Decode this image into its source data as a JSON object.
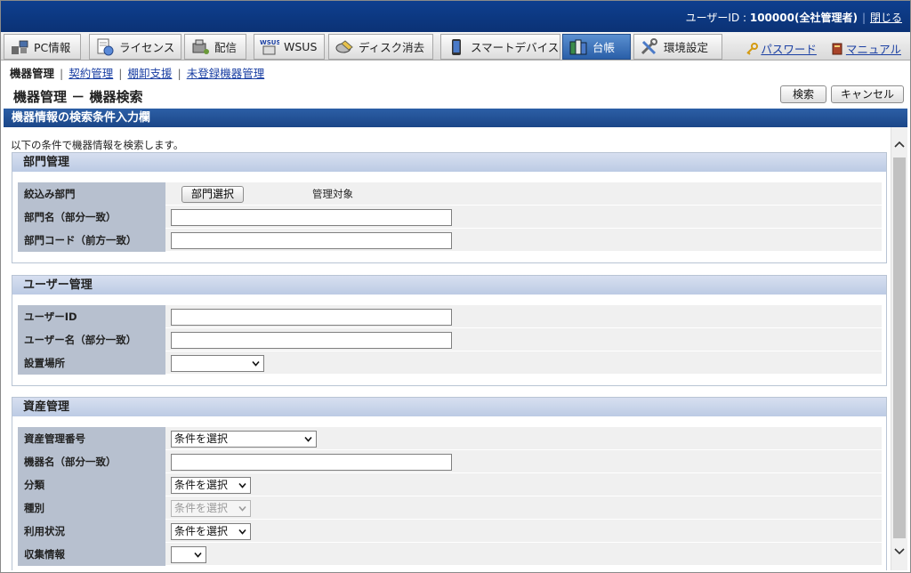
{
  "header": {
    "user_label": "ユーザーID : ",
    "user_value": "100000(全社管理者)",
    "close_label": "閉じる"
  },
  "nav": {
    "tabs": [
      {
        "label": "PC情報",
        "icon": "pc-info-icon"
      },
      {
        "label": "ライセンス",
        "icon": "license-icon"
      },
      {
        "label": "配信",
        "icon": "delivery-icon"
      },
      {
        "label": "WSUS",
        "icon": "wsus-icon"
      },
      {
        "label": "ディスク消去",
        "icon": "disk-erase-icon"
      },
      {
        "label": "スマートデバイス",
        "icon": "smart-device-icon"
      },
      {
        "label": "台帳",
        "icon": "ledger-icon",
        "active": true
      },
      {
        "label": "環境設定",
        "icon": "settings-tools-icon"
      }
    ],
    "password_label": "パスワード",
    "manual_label": "マニュアル"
  },
  "subnav": {
    "current": "機器管理",
    "links": [
      "契約管理",
      "棚卸支援",
      "未登録機器管理"
    ]
  },
  "page": {
    "title": "機器管理 － 機器検索",
    "search_button": "検索",
    "cancel_button": "キャンセル",
    "section_title": "機器情報の検索条件入力欄",
    "intro": "以下の条件で機器情報を検索します。"
  },
  "groups": {
    "dept": {
      "title": "部門管理",
      "filter_label": "絞込み部門",
      "select_button": "部門選択",
      "managed_text": "管理対象",
      "name_label": "部門名（部分一致）",
      "code_label": "部門コード（前方一致）"
    },
    "user": {
      "title": "ユーザー管理",
      "id_label": "ユーザーID",
      "name_label": "ユーザー名（部分一致）",
      "location_label": "設置場所",
      "location_value": ""
    },
    "asset": {
      "title": "資産管理",
      "number_label": "資産管理番号",
      "number_value": "条件を選択",
      "device_label": "機器名（部分一致）",
      "category_label": "分類",
      "category_value": "条件を選択",
      "type_label": "種別",
      "type_value": "条件を選択",
      "usage_label": "利用状況",
      "usage_value": "条件を選択",
      "collect_label": "収集情報",
      "collect_value": ""
    }
  },
  "colors": {
    "header_bg": "#0b3275",
    "active_tab": "#2a5fa8",
    "section_bar": "#1b4688",
    "label_bg": "#b7c0cf",
    "group_head": "#c8d4ea"
  }
}
